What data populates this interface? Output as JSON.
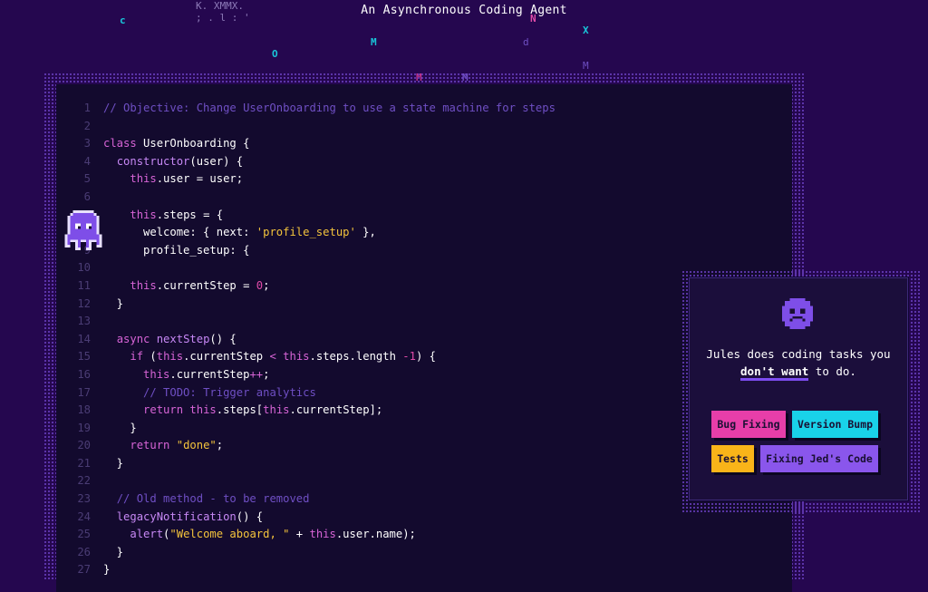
{
  "header": {
    "tagline": "An Asynchronous Coding Agent",
    "scatter_glyphs": [
      "c",
      "K. XMMX.",
      "; . l : '",
      "O",
      "M",
      "N",
      "d",
      "X",
      "M",
      "M",
      "M"
    ]
  },
  "editor": {
    "lines": [
      {
        "n": "1",
        "tokens": [
          {
            "t": "// Objective: Change UserOnboarding to use a state machine for steps",
            "c": "comment"
          }
        ]
      },
      {
        "n": "2",
        "tokens": []
      },
      {
        "n": "3",
        "tokens": [
          {
            "t": "class ",
            "c": "keyword"
          },
          {
            "t": "UserOnboarding {",
            "c": "plain"
          }
        ]
      },
      {
        "n": "4",
        "tokens": [
          {
            "t": "  ",
            "c": "plain"
          },
          {
            "t": "constructor",
            "c": "function"
          },
          {
            "t": "(user) {",
            "c": "plain"
          }
        ]
      },
      {
        "n": "5",
        "tokens": [
          {
            "t": "    ",
            "c": "plain"
          },
          {
            "t": "this",
            "c": "keyword"
          },
          {
            "t": ".user = user;",
            "c": "plain"
          }
        ]
      },
      {
        "n": "6",
        "tokens": []
      },
      {
        "n": "7",
        "tokens": [
          {
            "t": "    ",
            "c": "plain"
          },
          {
            "t": "this",
            "c": "keyword"
          },
          {
            "t": ".steps = {",
            "c": "plain"
          }
        ]
      },
      {
        "n": "8",
        "tokens": [
          {
            "t": "      welcome: { next: ",
            "c": "plain"
          },
          {
            "t": "'profile_setup'",
            "c": "string"
          },
          {
            "t": " },",
            "c": "plain"
          }
        ]
      },
      {
        "n": "9",
        "tokens": [
          {
            "t": "      profile_setup: {",
            "c": "plain"
          }
        ]
      },
      {
        "n": "10",
        "tokens": []
      },
      {
        "n": "11",
        "tokens": [
          {
            "t": "    ",
            "c": "plain"
          },
          {
            "t": "this",
            "c": "keyword"
          },
          {
            "t": ".currentStep = ",
            "c": "plain"
          },
          {
            "t": "0",
            "c": "number"
          },
          {
            "t": ";",
            "c": "plain"
          }
        ]
      },
      {
        "n": "12",
        "tokens": [
          {
            "t": "  }",
            "c": "plain"
          }
        ]
      },
      {
        "n": "13",
        "tokens": []
      },
      {
        "n": "14",
        "tokens": [
          {
            "t": "  ",
            "c": "plain"
          },
          {
            "t": "async ",
            "c": "keyword"
          },
          {
            "t": "nextStep",
            "c": "function"
          },
          {
            "t": "() {",
            "c": "plain"
          }
        ]
      },
      {
        "n": "15",
        "tokens": [
          {
            "t": "    ",
            "c": "plain"
          },
          {
            "t": "if",
            "c": "keyword"
          },
          {
            "t": " (",
            "c": "plain"
          },
          {
            "t": "this",
            "c": "keyword"
          },
          {
            "t": ".currentStep ",
            "c": "plain"
          },
          {
            "t": "<",
            "c": "operator"
          },
          {
            "t": " ",
            "c": "plain"
          },
          {
            "t": "this",
            "c": "keyword"
          },
          {
            "t": ".steps.length ",
            "c": "plain"
          },
          {
            "t": "-1",
            "c": "number"
          },
          {
            "t": ") {",
            "c": "plain"
          }
        ]
      },
      {
        "n": "16",
        "tokens": [
          {
            "t": "      ",
            "c": "plain"
          },
          {
            "t": "this",
            "c": "keyword"
          },
          {
            "t": ".currentStep",
            "c": "plain"
          },
          {
            "t": "++",
            "c": "operator"
          },
          {
            "t": ";",
            "c": "plain"
          }
        ]
      },
      {
        "n": "17",
        "tokens": [
          {
            "t": "      ",
            "c": "plain"
          },
          {
            "t": "// TODO: Trigger analytics",
            "c": "comment"
          }
        ]
      },
      {
        "n": "18",
        "tokens": [
          {
            "t": "      ",
            "c": "plain"
          },
          {
            "t": "return ",
            "c": "keyword"
          },
          {
            "t": "this",
            "c": "keyword"
          },
          {
            "t": ".steps[",
            "c": "plain"
          },
          {
            "t": "this",
            "c": "keyword"
          },
          {
            "t": ".currentStep];",
            "c": "plain"
          }
        ]
      },
      {
        "n": "19",
        "tokens": [
          {
            "t": "    }",
            "c": "plain"
          }
        ]
      },
      {
        "n": "20",
        "tokens": [
          {
            "t": "    ",
            "c": "plain"
          },
          {
            "t": "return ",
            "c": "keyword"
          },
          {
            "t": "\"done\"",
            "c": "string"
          },
          {
            "t": ";",
            "c": "plain"
          }
        ]
      },
      {
        "n": "21",
        "tokens": [
          {
            "t": "  }",
            "c": "plain"
          }
        ]
      },
      {
        "n": "22",
        "tokens": []
      },
      {
        "n": "23",
        "tokens": [
          {
            "t": "  ",
            "c": "plain"
          },
          {
            "t": "// Old method - to be removed",
            "c": "comment"
          }
        ]
      },
      {
        "n": "24",
        "tokens": [
          {
            "t": "  ",
            "c": "plain"
          },
          {
            "t": "legacyNotification",
            "c": "function"
          },
          {
            "t": "() {",
            "c": "plain"
          }
        ]
      },
      {
        "n": "25",
        "tokens": [
          {
            "t": "    ",
            "c": "plain"
          },
          {
            "t": "alert",
            "c": "function"
          },
          {
            "t": "(",
            "c": "plain"
          },
          {
            "t": "\"Welcome aboard, \"",
            "c": "string"
          },
          {
            "t": " + ",
            "c": "plain"
          },
          {
            "t": "this",
            "c": "keyword"
          },
          {
            "t": ".user.name);",
            "c": "plain"
          }
        ]
      },
      {
        "n": "26",
        "tokens": [
          {
            "t": "  }",
            "c": "plain"
          }
        ]
      },
      {
        "n": "27",
        "tokens": [
          {
            "t": "}",
            "c": "plain"
          }
        ]
      }
    ]
  },
  "mascot": {
    "icon": "purple-octopus-icon"
  },
  "card": {
    "face_icon": "sad-face-icon",
    "text_line1": "Jules does coding tasks you",
    "text_strong": "don't want",
    "text_rest": " to do.",
    "chips": [
      {
        "label": "Bug Fixing",
        "color": "#e73ea9"
      },
      {
        "label": "Version Bump",
        "color": "#19d2e9"
      },
      {
        "label": "Tests",
        "color": "#f9b419"
      },
      {
        "label": "Fixing Jed's Code",
        "color": "#8a56ec"
      }
    ]
  },
  "colors": {
    "background": "#25074f",
    "editor_bg": "#130a2e",
    "comment": "#6f4fc4",
    "keyword": "#d764d6",
    "string": "#f4c43c",
    "number": "#e04ba8"
  }
}
